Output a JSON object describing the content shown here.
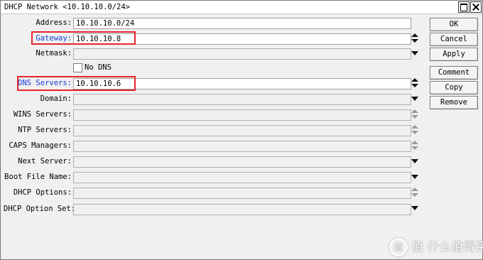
{
  "window": {
    "title": "DHCP Network <10.10.10.0/24>"
  },
  "fields": [
    {
      "label": "Address:",
      "value": "10.10.10.0/24"
    },
    {
      "label": "Gateway:",
      "value": "10.10.10.8"
    },
    {
      "label": "Netmask:",
      "value": ""
    },
    {
      "label": "DNS Servers:",
      "value": "10.10.10.6"
    },
    {
      "label": "Domain:",
      "value": ""
    },
    {
      "label": "WINS Servers:",
      "value": ""
    },
    {
      "label": "NTP Servers:",
      "value": ""
    },
    {
      "label": "CAPS Managers:",
      "value": ""
    },
    {
      "label": "Next Server:",
      "value": ""
    },
    {
      "label": "Boot File Name:",
      "value": ""
    },
    {
      "label": "DHCP Options:",
      "value": ""
    },
    {
      "label": "DHCP Option Set:",
      "value": ""
    }
  ],
  "no_dns": {
    "label": "No DNS",
    "checked": false
  },
  "buttons": {
    "ok": "OK",
    "cancel": "Cancel",
    "apply": "Apply",
    "comment": "Comment",
    "copy": "Copy",
    "remove": "Remove"
  },
  "watermark": {
    "text": "值 什么值得买",
    "logo": "值"
  },
  "highlight_color": "#e3262c",
  "label_link_color": "#1a3bd6"
}
